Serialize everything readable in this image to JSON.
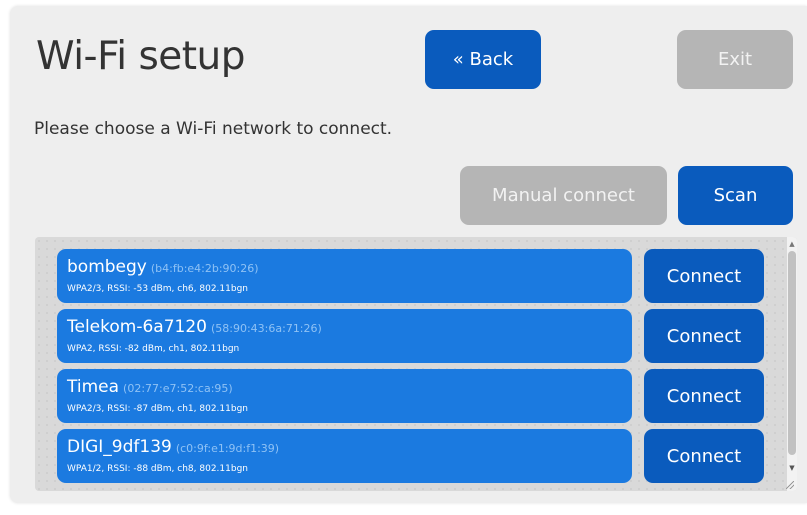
{
  "header": {
    "title": "Wi-Fi setup",
    "back_label": "« Back",
    "exit_label": "Exit"
  },
  "subtitle": "Please choose a Wi-Fi network to connect.",
  "actions": {
    "manual_label": "Manual connect",
    "scan_label": "Scan"
  },
  "networks": [
    {
      "ssid": "bombegy",
      "mac": "(b4:fb:e4:2b:90:26)",
      "details": "WPA2/3, RSSI: -53 dBm, ch6, 802.11bgn",
      "connect_label": "Connect"
    },
    {
      "ssid": "Telekom-6a7120",
      "mac": "(58:90:43:6a:71:26)",
      "details": "WPA2, RSSI: -82 dBm, ch1, 802.11bgn",
      "connect_label": "Connect"
    },
    {
      "ssid": "Timea",
      "mac": "(02:77:e7:52:ca:95)",
      "details": "WPA2/3, RSSI: -87 dBm, ch1, 802.11bgn",
      "connect_label": "Connect"
    },
    {
      "ssid": "DIGI_9df139",
      "mac": "(c0:9f:e1:9d:f1:39)",
      "details": "WPA1/2, RSSI: -88 dBm, ch8, 802.11bgn",
      "connect_label": "Connect"
    }
  ],
  "colors": {
    "primary": "#0a5bbd",
    "network_bg": "#1b7ae0",
    "disabled": "#b5b5b5",
    "panel_bg": "#eeeeee"
  }
}
